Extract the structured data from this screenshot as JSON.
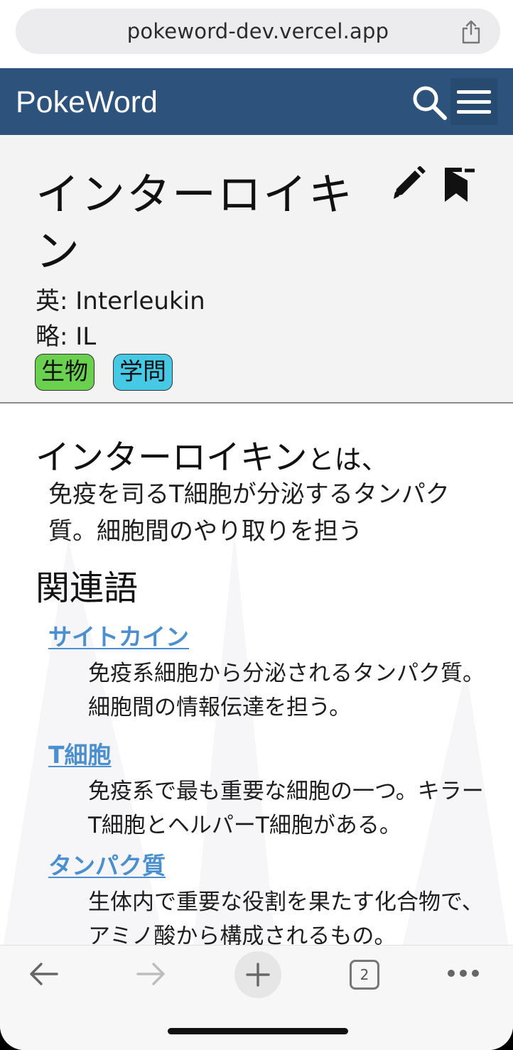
{
  "browser": {
    "url": "pokeword-dev.vercel.app",
    "tab_count": "2"
  },
  "app": {
    "brand": "PokeWord"
  },
  "word": {
    "title": "インターロイキン",
    "english": "英: Interleukin",
    "abbreviation": "略: IL",
    "tags": [
      {
        "label": "生物",
        "color": "#6ad14f"
      },
      {
        "label": "学問",
        "color": "#46c9e5"
      }
    ]
  },
  "definition": {
    "term": "インターロイキン",
    "suffix": "とは、",
    "body": "免疫を司るT細胞が分泌するタンパク質。細胞間のやり取りを担う"
  },
  "related": {
    "heading": "関連語",
    "items": [
      {
        "term": "サイトカイン",
        "desc": "免疫系細胞から分泌されるタンパク質。細胞間の情報伝達を担う。"
      },
      {
        "term": "T細胞",
        "desc": "免疫系で最も重要な細胞の一つ。キラーT細胞とヘルパーT細胞がある。"
      },
      {
        "term": "タンパク質",
        "desc": "生体内で重要な役割を果たす化合物で、アミノ酸から構成されるもの。"
      }
    ]
  },
  "colors": {
    "header_bg": "#2d527c",
    "link": "#4a8fd0"
  }
}
